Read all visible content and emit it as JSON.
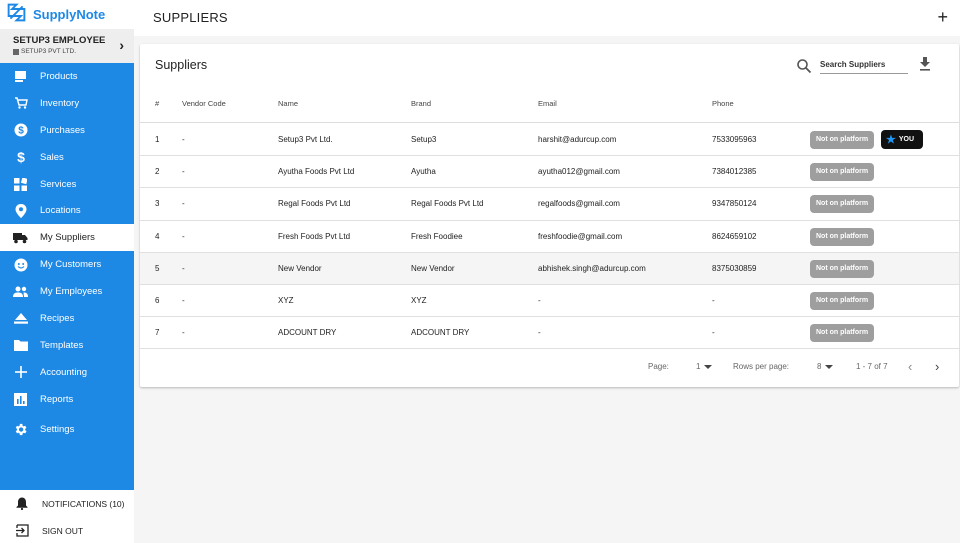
{
  "app": {
    "name": "SupplyNote"
  },
  "user": {
    "name": "SETUP3 EMPLOYEE",
    "org": "SETUP3 PVT LTD."
  },
  "sidebar": {
    "items": [
      {
        "label": "Products",
        "icon": "products-icon"
      },
      {
        "label": "Inventory",
        "icon": "cart-icon"
      },
      {
        "label": "Purchases",
        "icon": "dollar-circle-icon"
      },
      {
        "label": "Sales",
        "icon": "dollar-icon"
      },
      {
        "label": "Services",
        "icon": "grid-icon"
      },
      {
        "label": "Locations",
        "icon": "location-pin-icon"
      },
      {
        "label": "My Suppliers",
        "icon": "truck-icon",
        "active": true
      },
      {
        "label": "My Customers",
        "icon": "smiley-icon"
      },
      {
        "label": "My Employees",
        "icon": "people-icon"
      },
      {
        "label": "Recipes",
        "icon": "eject-icon"
      },
      {
        "label": "Templates",
        "icon": "folder-icon"
      },
      {
        "label": "Accounting",
        "icon": "plus-icon"
      },
      {
        "label": "Reports",
        "icon": "bar-chart-icon"
      },
      {
        "label": "Settings",
        "icon": "gear-icon"
      }
    ],
    "notifications": "NOTIFICATIONS (10)",
    "signout": "SIGN OUT"
  },
  "header": {
    "title": "SUPPLIERS",
    "add": "+"
  },
  "card": {
    "title": "Suppliers",
    "search_placeholder": "Search Suppliers"
  },
  "table": {
    "columns": [
      "#",
      "Vendor Code",
      "Name",
      "Brand",
      "Email",
      "Phone"
    ],
    "rows": [
      {
        "n": "1",
        "code": "-",
        "name": "Setup3 Pvt Ltd.",
        "brand": "Setup3",
        "email": "harshit@adurcup.com",
        "phone": "7533095963",
        "status": "Not on platform",
        "you": "YOU"
      },
      {
        "n": "2",
        "code": "-",
        "name": "Ayutha Foods Pvt Ltd",
        "brand": "Ayutha",
        "email": "ayutha012@gmail.com",
        "phone": "7384012385",
        "status": "Not on platform"
      },
      {
        "n": "3",
        "code": "-",
        "name": "Regal Foods Pvt Ltd",
        "brand": "Regal Foods Pvt Ltd",
        "email": "regalfoods@gmail.com",
        "phone": "9347850124",
        "status": "Not on platform"
      },
      {
        "n": "4",
        "code": "-",
        "name": "Fresh Foods Pvt Ltd",
        "brand": "Fresh Foodiee",
        "email": "freshfoodie@gmail.com",
        "phone": "8624659102",
        "status": "Not on platform"
      },
      {
        "n": "5",
        "code": "-",
        "name": "New Vendor",
        "brand": "New Vendor",
        "email": "abhishek.singh@adurcup.com",
        "phone": "8375030859",
        "status": "Not on platform"
      },
      {
        "n": "6",
        "code": "-",
        "name": "XYZ",
        "brand": "XYZ",
        "email": "-",
        "phone": "-",
        "status": "Not on platform"
      },
      {
        "n": "7",
        "code": "-",
        "name": "ADCOUNT DRY",
        "brand": "ADCOUNT DRY",
        "email": "-",
        "phone": "-",
        "status": "Not on platform"
      }
    ]
  },
  "pagination": {
    "page_label": "Page:",
    "page": "1",
    "rows_label": "Rows per page:",
    "rows_per_page": "8",
    "range": "1 - 7 of 7",
    "prev": "‹",
    "next": "›"
  },
  "colors": {
    "accent": "#1e88e5",
    "badge": "#9e9e9e",
    "you_bg": "#111111"
  }
}
